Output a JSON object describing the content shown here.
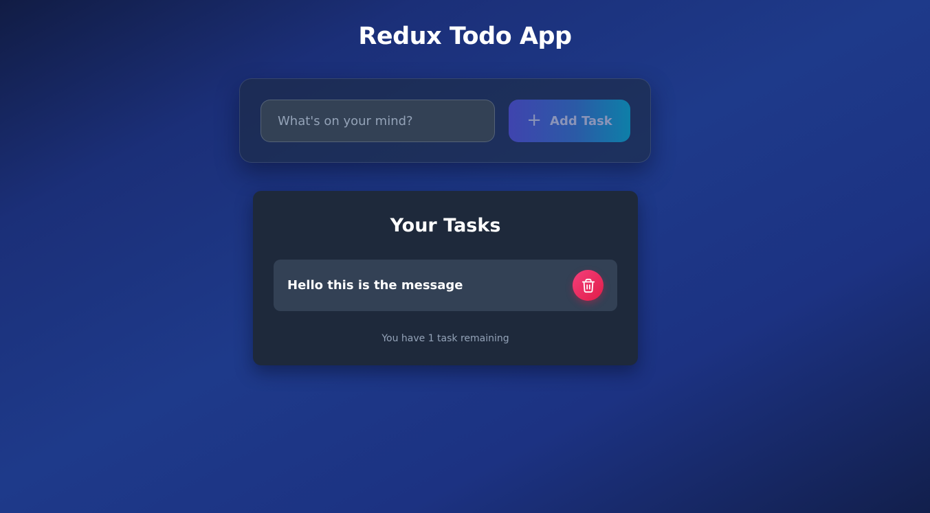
{
  "app": {
    "title": "Redux Todo App"
  },
  "input_form": {
    "placeholder": "What's on your mind?",
    "value": "",
    "add_button_label": "Add Task",
    "add_button_icon": "plus-icon"
  },
  "task_list": {
    "title": "Your Tasks",
    "items": [
      {
        "text": "Hello this is the message",
        "delete_icon": "trash-icon"
      }
    ],
    "remaining_text": "You have 1 task remaining"
  },
  "colors": {
    "delete_accent": "#e11d48",
    "button_gradient_start": "#3f44ae",
    "button_gradient_end": "#0e7fa8",
    "card_background": "#1e293b",
    "task_background": "#334155"
  }
}
